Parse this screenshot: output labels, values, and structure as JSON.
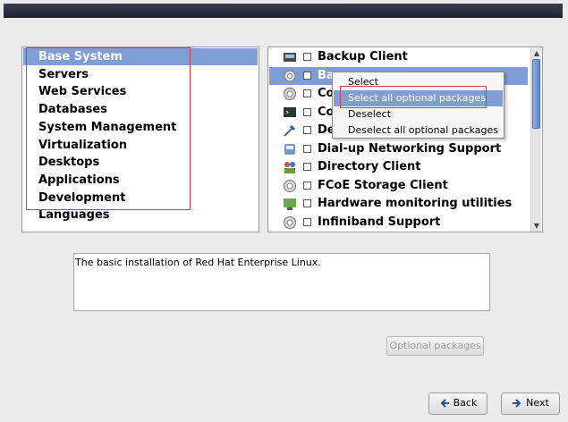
{
  "categories": [
    {
      "label": "Base System",
      "selected": true
    },
    {
      "label": "Servers",
      "selected": false
    },
    {
      "label": "Web Services",
      "selected": false
    },
    {
      "label": "Databases",
      "selected": false
    },
    {
      "label": "System Management",
      "selected": false
    },
    {
      "label": "Virtualization",
      "selected": false
    },
    {
      "label": "Desktops",
      "selected": false
    },
    {
      "label": "Applications",
      "selected": false
    },
    {
      "label": "Development",
      "selected": false
    },
    {
      "label": "Languages",
      "selected": false
    }
  ],
  "packages": [
    {
      "label": "Backup Client",
      "icon": "backup-icon",
      "selected": false
    },
    {
      "label": "Ba",
      "icon": "base-icon",
      "selected": true
    },
    {
      "label": "Co",
      "icon": "compat-icon",
      "selected": false
    },
    {
      "label": "Co",
      "icon": "console-icon",
      "selected": false
    },
    {
      "label": "De",
      "icon": "debug-icon",
      "selected": false
    },
    {
      "label": "Dial-up Networking Support",
      "icon": "phone-icon",
      "selected": false
    },
    {
      "label": "Directory Client",
      "icon": "users-icon",
      "selected": false
    },
    {
      "label": "FCoE Storage Client",
      "icon": "storage-icon",
      "selected": false
    },
    {
      "label": "Hardware monitoring utilities",
      "icon": "monitor-icon",
      "selected": false
    },
    {
      "label": "Infiniband Support",
      "icon": "infiniband-icon",
      "selected": false
    }
  ],
  "context_menu": [
    {
      "label": "Select",
      "highlighted": false
    },
    {
      "label": "Select all optional packages",
      "highlighted": true
    },
    {
      "label": "Deselect",
      "highlighted": false
    },
    {
      "label": "Deselect all optional packages",
      "highlighted": false
    }
  ],
  "description": "The basic installation of Red Hat Enterprise Linux.",
  "buttons": {
    "optional_packages": "Optional packages",
    "back": "Back",
    "next": "Next"
  },
  "colors": {
    "selection": "#7f9ed6",
    "annotation_red": "#d04040"
  }
}
